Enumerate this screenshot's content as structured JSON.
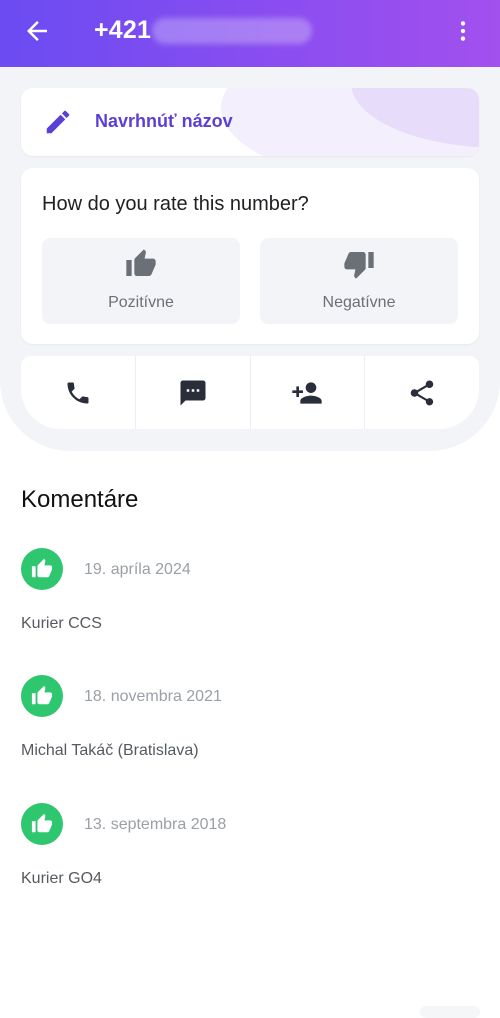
{
  "appbar": {
    "title": "+421",
    "icons": {
      "back": "arrow-left-icon",
      "menu": "more-vert-icon"
    },
    "gradient": [
      "#6a4cf2",
      "#a250ee"
    ]
  },
  "suggest": {
    "label": "Navrhnúť názov",
    "icon": "pencil-icon"
  },
  "rating": {
    "question": "How do you rate this number?",
    "positive": {
      "label": "Pozitívne",
      "icon": "thumb-up-icon"
    },
    "negative": {
      "label": "Negatívne",
      "icon": "thumb-down-icon"
    }
  },
  "actions": [
    {
      "name": "call",
      "icon": "phone-icon"
    },
    {
      "name": "message",
      "icon": "message-icon"
    },
    {
      "name": "add-contact",
      "icon": "add-person-icon"
    },
    {
      "name": "share",
      "icon": "share-icon"
    }
  ],
  "comments": {
    "title": "Komentáre",
    "items": [
      {
        "date": "19. apríla 2024",
        "text": "Kurier CCS",
        "rating": "positive"
      },
      {
        "date": "18. novembra 2021",
        "text": "Michal Takáč (Bratislava)",
        "rating": "positive"
      },
      {
        "date": "13. septembra 2018",
        "text": "Kurier GO4",
        "rating": "positive"
      }
    ]
  },
  "colors": {
    "accent": "#5b3fd6",
    "positive": "#2ec770",
    "panel": "#f2f4f7"
  }
}
